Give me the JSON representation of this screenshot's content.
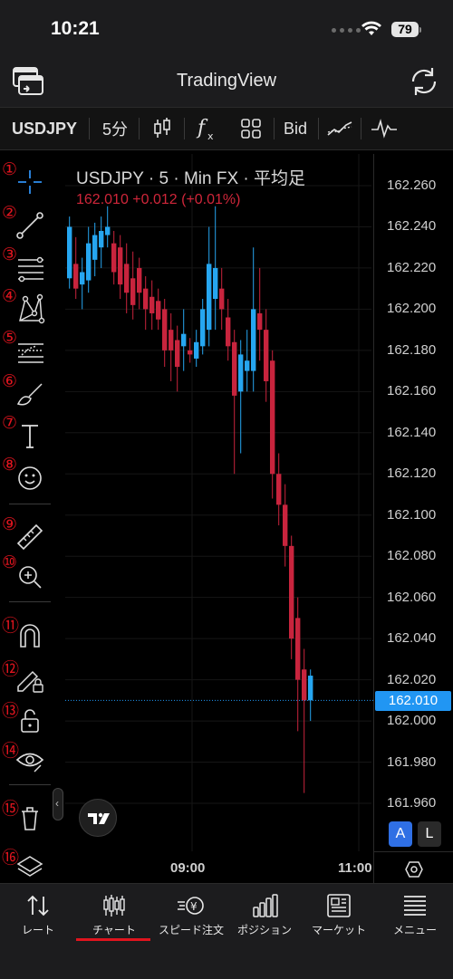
{
  "status_bar": {
    "time": "10:21",
    "battery": "79",
    "icons": [
      "signal-dots-icon",
      "wifi-icon",
      "battery-icon"
    ]
  },
  "app": {
    "title": "TradingView",
    "left_icon": "window-switch-icon",
    "right_icon": "refresh-icon"
  },
  "chart_toolbar": {
    "symbol": "USDJPY",
    "interval": "5分",
    "price_type": "Bid",
    "icons": [
      "candlestick-icon",
      "indicator-fx-icon",
      "layout-grid-icon",
      "compare-icon",
      "pulse-icon"
    ]
  },
  "drawing_tools": [
    {
      "num": "①",
      "icon": "crosshair-icon"
    },
    {
      "num": "②",
      "icon": "trend-line-icon"
    },
    {
      "num": "③",
      "icon": "fib-lines-icon"
    },
    {
      "num": "④",
      "icon": "pattern-icon"
    },
    {
      "num": "⑤",
      "icon": "forecast-icon"
    },
    {
      "num": "⑥",
      "icon": "brush-icon"
    },
    {
      "num": "⑦",
      "icon": "text-icon"
    },
    {
      "num": "⑧",
      "icon": "emoji-icon"
    },
    {
      "num": "⑨",
      "icon": "ruler-icon"
    },
    {
      "num": "⑩",
      "icon": "zoom-in-icon"
    },
    {
      "num": "⑪",
      "icon": "magnet-icon"
    },
    {
      "num": "⑫",
      "icon": "lock-drawing-icon"
    },
    {
      "num": "⑬",
      "icon": "unlock-icon"
    },
    {
      "num": "⑭",
      "icon": "eye-icon"
    },
    {
      "num": "⑮",
      "icon": "trash-icon"
    },
    {
      "num": "⑯",
      "icon": "layers-icon"
    }
  ],
  "chart": {
    "legend_title": "USDJPY · 5 · Min FX · 平均足",
    "legend_price": "162.010  +0.012 (+0.01%)",
    "price_labels": [
      "162.260",
      "162.240",
      "162.220",
      "162.200",
      "162.180",
      "162.160",
      "162.140",
      "162.120",
      "162.100",
      "162.080",
      "162.060",
      "162.040",
      "162.020",
      "162.000",
      "161.980",
      "161.960"
    ],
    "current_price": "162.010",
    "time_labels": [
      "09:00",
      "11:00"
    ],
    "scale_buttons": {
      "auto": "A",
      "log": "L"
    },
    "colors": {
      "up": "#26a6f0",
      "down": "#c8243d",
      "current_line": "#2196f3"
    }
  },
  "chart_data": {
    "type": "candlestick",
    "title": "USDJPY · 5 · Min FX · 平均足",
    "ylim": [
      161.955,
      162.265
    ],
    "x_ticks": [
      "09:00",
      "11:00"
    ],
    "y_ticks": [
      162.26,
      162.24,
      162.22,
      162.2,
      162.18,
      162.16,
      162.14,
      162.12,
      162.1,
      162.08,
      162.06,
      162.04,
      162.02,
      162.0,
      161.98,
      161.96
    ],
    "last_price": 162.01,
    "candles": [
      {
        "o": 162.215,
        "h": 162.245,
        "l": 162.21,
        "c": 162.24
      },
      {
        "o": 162.222,
        "h": 162.235,
        "l": 162.205,
        "c": 162.21
      },
      {
        "o": 162.212,
        "h": 162.225,
        "l": 162.2,
        "c": 162.218
      },
      {
        "o": 162.214,
        "h": 162.24,
        "l": 162.208,
        "c": 162.232
      },
      {
        "o": 162.224,
        "h": 162.242,
        "l": 162.216,
        "c": 162.236
      },
      {
        "o": 162.23,
        "h": 162.245,
        "l": 162.22,
        "c": 162.238
      },
      {
        "o": 162.236,
        "h": 162.25,
        "l": 162.23,
        "c": 162.24
      },
      {
        "o": 162.232,
        "h": 162.238,
        "l": 162.212,
        "c": 162.218
      },
      {
        "o": 162.23,
        "h": 162.236,
        "l": 162.205,
        "c": 162.212
      },
      {
        "o": 162.222,
        "h": 162.232,
        "l": 162.198,
        "c": 162.208
      },
      {
        "o": 162.215,
        "h": 162.228,
        "l": 162.195,
        "c": 162.202
      },
      {
        "o": 162.22,
        "h": 162.225,
        "l": 162.2,
        "c": 162.208
      },
      {
        "o": 162.21,
        "h": 162.216,
        "l": 162.19,
        "c": 162.2
      },
      {
        "o": 162.206,
        "h": 162.214,
        "l": 162.19,
        "c": 162.198
      },
      {
        "o": 162.204,
        "h": 162.21,
        "l": 162.19,
        "c": 162.195
      },
      {
        "o": 162.2,
        "h": 162.205,
        "l": 162.172,
        "c": 162.18
      },
      {
        "o": 162.19,
        "h": 162.198,
        "l": 162.165,
        "c": 162.18
      },
      {
        "o": 162.185,
        "h": 162.192,
        "l": 162.16,
        "c": 162.172
      },
      {
        "o": 162.182,
        "h": 162.2,
        "l": 162.17,
        "c": 162.188
      },
      {
        "o": 162.18,
        "h": 162.186,
        "l": 162.174,
        "c": 162.178
      },
      {
        "o": 162.176,
        "h": 162.19,
        "l": 162.172,
        "c": 162.184
      },
      {
        "o": 162.182,
        "h": 162.205,
        "l": 162.178,
        "c": 162.2
      },
      {
        "o": 162.19,
        "h": 162.24,
        "l": 162.182,
        "c": 162.222
      },
      {
        "o": 162.205,
        "h": 162.25,
        "l": 162.19,
        "c": 162.22
      },
      {
        "o": 162.21,
        "h": 162.22,
        "l": 162.19,
        "c": 162.2
      },
      {
        "o": 162.196,
        "h": 162.205,
        "l": 162.175,
        "c": 162.182
      },
      {
        "o": 162.184,
        "h": 162.19,
        "l": 162.12,
        "c": 162.158
      },
      {
        "o": 162.16,
        "h": 162.185,
        "l": 162.13,
        "c": 162.178
      },
      {
        "o": 162.17,
        "h": 162.19,
        "l": 162.16,
        "c": 162.175
      },
      {
        "o": 162.17,
        "h": 162.23,
        "l": 162.16,
        "c": 162.2
      },
      {
        "o": 162.198,
        "h": 162.22,
        "l": 162.175,
        "c": 162.19
      },
      {
        "o": 162.19,
        "h": 162.2,
        "l": 162.155,
        "c": 162.165
      },
      {
        "o": 162.175,
        "h": 162.18,
        "l": 162.108,
        "c": 162.12
      },
      {
        "o": 162.12,
        "h": 162.13,
        "l": 162.095,
        "c": 162.105
      },
      {
        "o": 162.105,
        "h": 162.115,
        "l": 162.075,
        "c": 162.085
      },
      {
        "o": 162.085,
        "h": 162.09,
        "l": 162.03,
        "c": 162.04
      },
      {
        "o": 162.05,
        "h": 162.06,
        "l": 161.995,
        "c": 162.02
      },
      {
        "o": 162.025,
        "h": 162.035,
        "l": 161.965,
        "c": 162.01
      },
      {
        "o": 162.01,
        "h": 162.025,
        "l": 162.0,
        "c": 162.022
      }
    ]
  },
  "tabs": [
    {
      "label": "レート",
      "icon": "rate-arrows-icon"
    },
    {
      "label": "チャート",
      "icon": "chart-candles-icon",
      "active": true
    },
    {
      "label": "スピード注文",
      "icon": "speed-order-icon"
    },
    {
      "label": "ポジション",
      "icon": "position-bars-icon"
    },
    {
      "label": "マーケット",
      "icon": "news-icon"
    },
    {
      "label": "メニュー",
      "icon": "menu-lines-icon"
    }
  ]
}
